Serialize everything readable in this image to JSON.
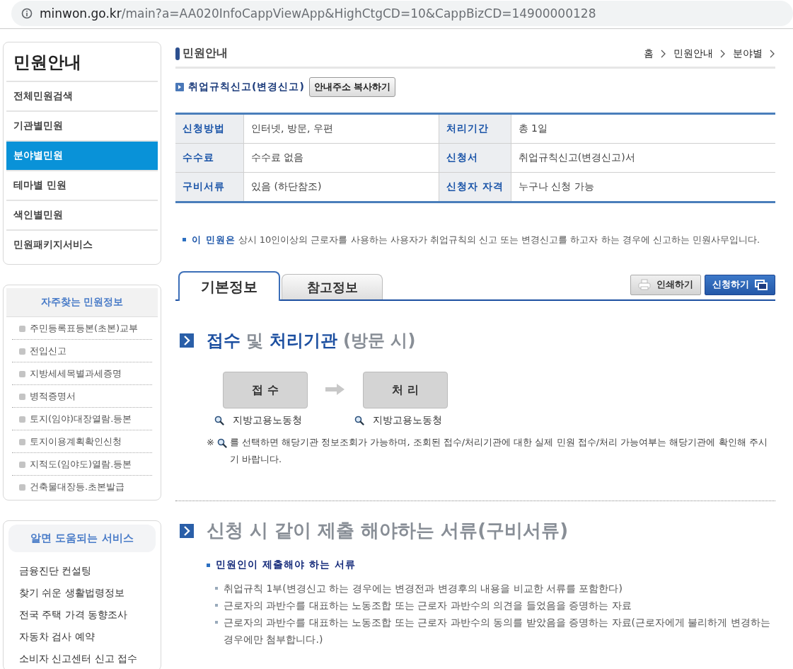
{
  "address_bar": {
    "host": "minwon.go.kr",
    "path": "/main?a=AA020InfoCappViewApp&HighCtgCD=10&CappBizCD=14900000128"
  },
  "sidebar": {
    "title": "민원안내",
    "items": [
      {
        "label": "전체민원검색",
        "selected": false
      },
      {
        "label": "기관별민원",
        "selected": false
      },
      {
        "label": "분야별민원",
        "selected": true
      },
      {
        "label": "테마별 민원",
        "selected": false
      },
      {
        "label": "색인별민원",
        "selected": false
      },
      {
        "label": "민원패키지서비스",
        "selected": false
      }
    ]
  },
  "frequent": {
    "title": "자주찾는 민원정보",
    "items": [
      "주민등록표등본(초본)교부",
      "전입신고",
      "지방세세목별과세증명",
      "병적증명서",
      "토지(임야)대장열람.등본",
      "토지이용계획확인신청",
      "지적도(임야도)열람.등본",
      "건축물대장등.초본발급"
    ]
  },
  "helpful": {
    "title": "알면 도움되는 서비스",
    "items": [
      "금융진단 컨설팅",
      "찾기 쉬운 생활법령정보",
      "전국 주택 가격 동향조사",
      "자동차 검사 예약",
      "소비자 신고센터 신고 접수"
    ]
  },
  "page": {
    "title": "민원안내",
    "breadcrumb": [
      "홈",
      "민원안내",
      "분야별"
    ],
    "service_name": "취업규칙신고(변경신고)",
    "copy_button": "안내주소 복사하기"
  },
  "summary": [
    {
      "label": "신청방법",
      "value": "인터넷, 방문, 우편"
    },
    {
      "label": "처리기간",
      "value": "총 1일"
    },
    {
      "label": "수수료",
      "value": "수수료 없음"
    },
    {
      "label": "신청서",
      "value": "취업규칙신고(변경신고)서"
    },
    {
      "label": "구비서류",
      "value": "있음 (하단참조)"
    },
    {
      "label": "신청자 자격",
      "value": "누구나 신청 가능"
    }
  ],
  "intro": "**이 민원은** 상시 10인이상의 근로자를 사용하는 사용자가 취업규칙의 신고 또는 변경신고를 하고자 하는 경우에 신고하는 민원사무입니다.",
  "tabs": [
    {
      "label": "기본정보",
      "selected": true
    },
    {
      "label": "참고정보",
      "selected": false
    }
  ],
  "actions": [
    {
      "label": "인쇄하기",
      "kind": "print"
    },
    {
      "label": "신청하기",
      "kind": "apply"
    }
  ],
  "agency_section": {
    "heading": [
      {
        "text": "접수",
        "emphasis": true
      },
      {
        "text": " 및 ",
        "emphasis": false
      },
      {
        "text": "처리기관",
        "emphasis": true
      },
      {
        "text": " (방문 시)",
        "emphasis": false
      }
    ],
    "steps": [
      {
        "label": "접 수",
        "agency": "지방고용노동청"
      },
      {
        "label": "처 리",
        "agency": "지방고용노동청"
      }
    ],
    "note_mark": "※",
    "note": "를 선택하면 해당기관 정보조회가 가능하며, 조회된 접수/처리기관에 대한 실제 민원 접수/처리 가능여부는 해당기관에 확인해 주시기 바랍니다."
  },
  "documents_section": {
    "heading": "신청 시 같이 제출 해야하는 서류(구비서류)",
    "subheading": "민원인이 제출해야 하는 서류",
    "items": [
      "취업규칙 1부(변경신고 하는 경우에는 변경전과 변경후의 내용을 비교한 서류를 포함한다)",
      "근로자의 과반수를 대표하는 노동조합 또는 근로자 과반수의 의견을 들었음을 증명하는 자료",
      "근로자의 과반수를 대표하는 노동조합 또는 근로자 과반수의 동의를 받았음을 증명하는 자료(근로자에게 불리하게 변경하는 경우에만 첨부합니다.)"
    ]
  }
}
